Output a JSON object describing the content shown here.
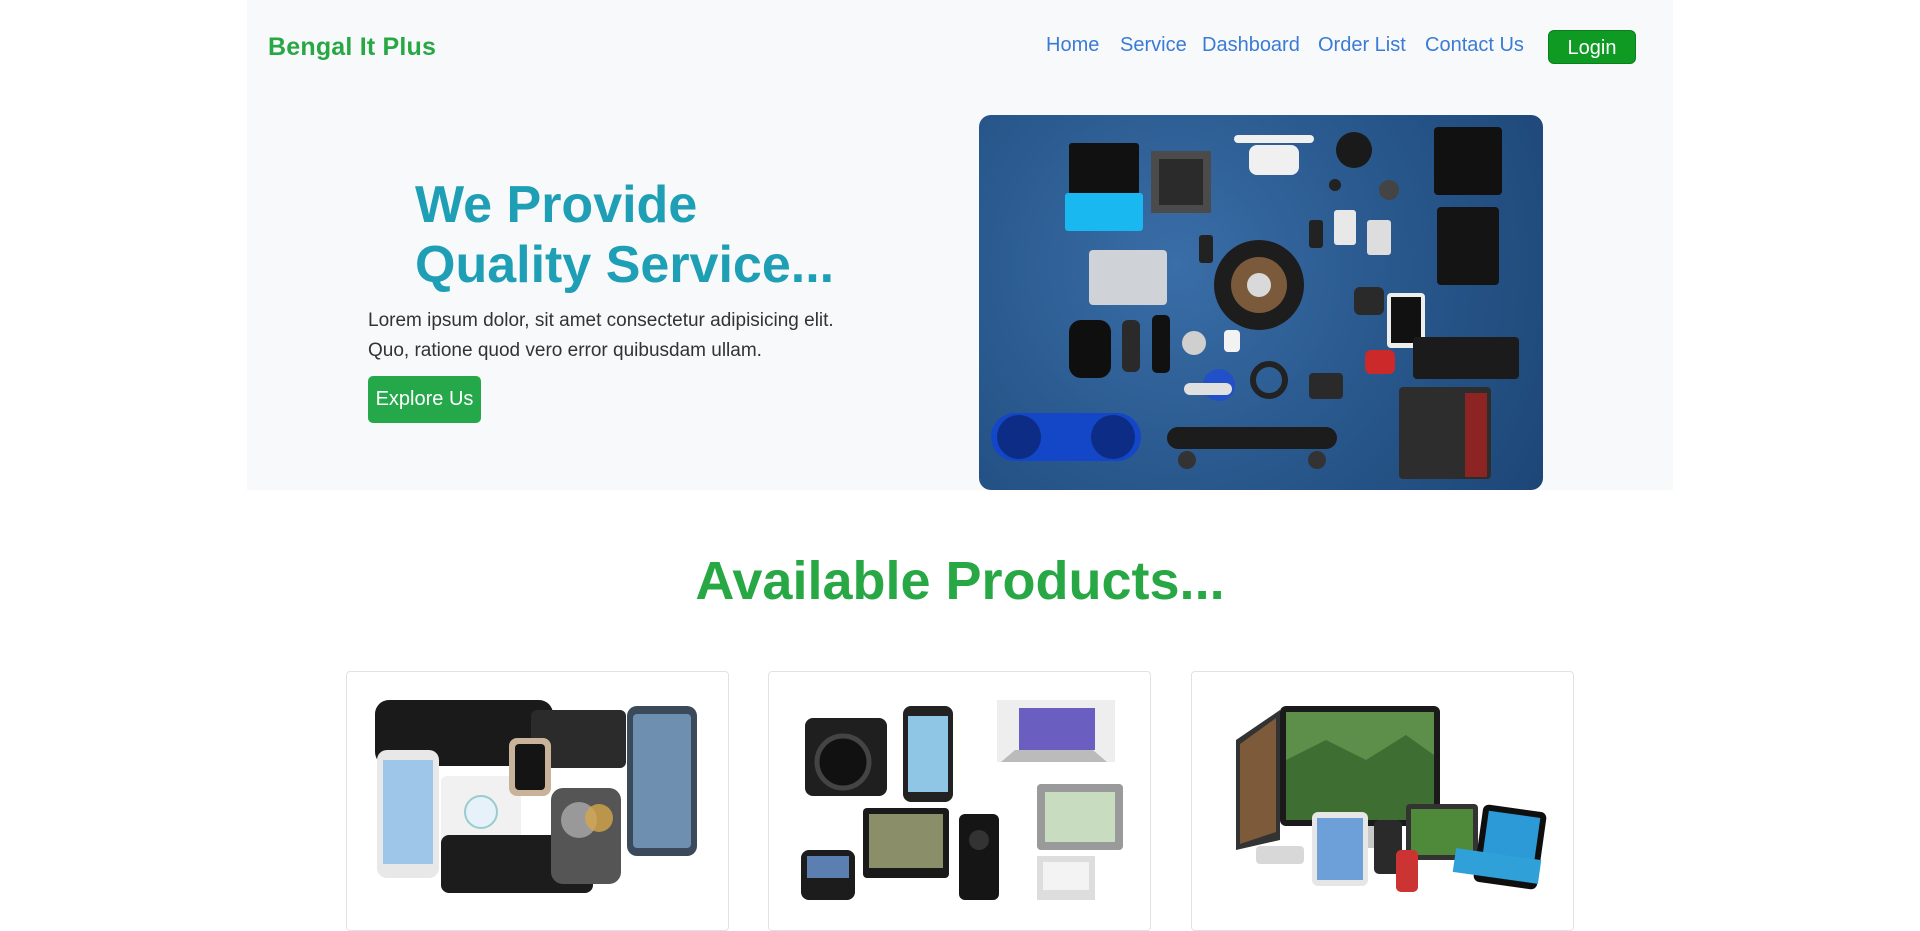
{
  "header": {
    "brand": "Bengal It Plus",
    "nav": [
      "Home",
      "Service",
      "Dashboard",
      "Order List",
      "Contact Us"
    ],
    "login_label": "Login"
  },
  "hero": {
    "title_line1": "We Provide",
    "title_line2": "Quality Service...",
    "text_line1": "Lorem ipsum dolor, sit amet consectetur adipisicing elit.",
    "text_line2": "Quo, ratione quod vero error quibusdam ullam.",
    "button_label": "Explore Us",
    "image_alt": "tech-gadgets-flatlay"
  },
  "products": {
    "title": "Available Products...",
    "cards": [
      {
        "image": "smart-home-devices"
      },
      {
        "image": "consumer-electronics"
      },
      {
        "image": "apple-devices"
      }
    ]
  },
  "colors": {
    "brand_green": "#28a745",
    "nav_blue": "#3a7bd5",
    "hero_title": "#1e9fb6",
    "login_green": "#0f9a23"
  }
}
